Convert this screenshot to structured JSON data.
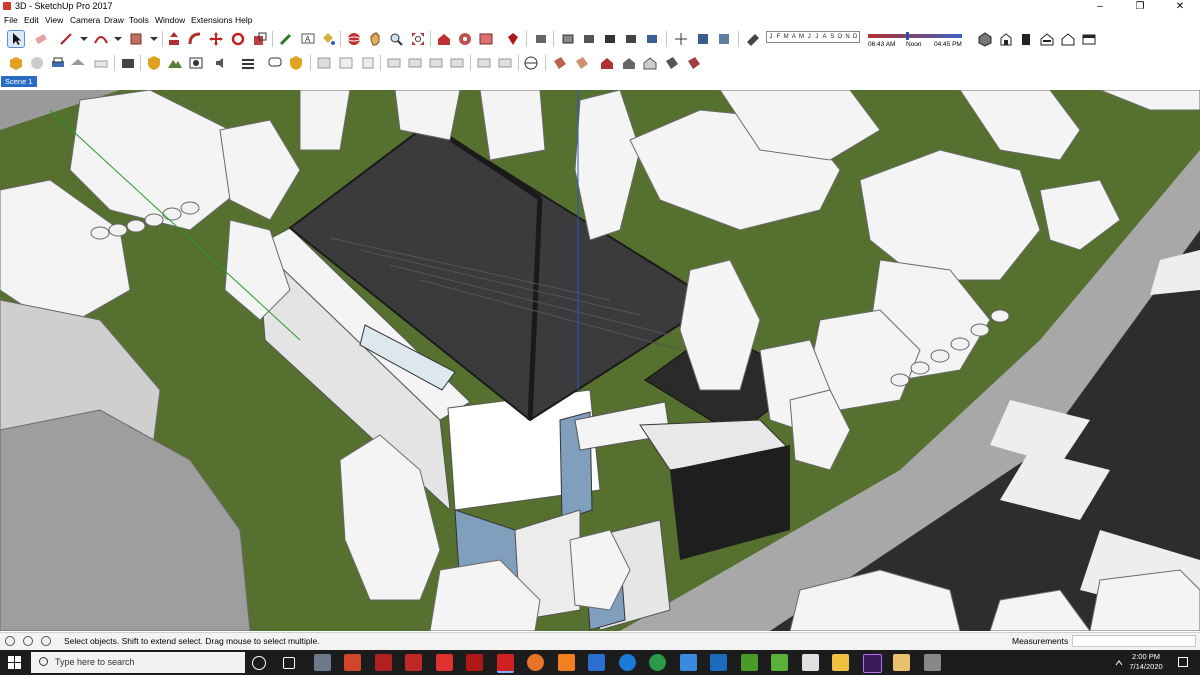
{
  "window": {
    "title": "3D - SketchUp Pro 2017",
    "minimize_icon": "minimize-icon",
    "maximize_icon": "restore-icon",
    "close_icon": "close-icon"
  },
  "menu": [
    "File",
    "Edit",
    "View",
    "Camera",
    "Draw",
    "Tools",
    "Window",
    "Extensions",
    "Help"
  ],
  "toolbar_row1_icons": [
    "select-icon",
    "eraser-icon",
    "line-icon",
    "arc-icon",
    "rectangle-icon",
    "push-pull-icon",
    "follow-me-icon",
    "move-icon",
    "rotate-icon",
    "scale-icon",
    "tape-measure-icon",
    "text-icon",
    "paint-bucket-icon",
    "orbit-icon",
    "pan-icon",
    "zoom-icon",
    "zoom-extents-icon",
    "warehouse-icon",
    "extension-warehouse-icon",
    "layout-icon",
    "sandbox-icon",
    "views-icons",
    "shadow-toggle-icon",
    "iso-view-icon",
    "top-view-icon",
    "front-view-icon",
    "right-view-icon",
    "back-view-icon",
    "left-view-icon"
  ],
  "shadow_settings": {
    "months": [
      "J",
      "F",
      "M",
      "A",
      "M",
      "J",
      "J",
      "A",
      "S",
      "O",
      "N",
      "D"
    ],
    "time_start": "06:43 AM",
    "time_mid": "Noon",
    "time_end": "04:45 PM"
  },
  "scene": {
    "tab_label": "Scene 1"
  },
  "status": {
    "message": "Select objects. Shift to extend select. Drag mouse to select multiple.",
    "measurements_label": "Measurements",
    "measurements_value": ""
  },
  "taskbar": {
    "search_placeholder": "Type here to search",
    "time": "2:00 PM",
    "date": "7/14/2020"
  },
  "colors": {
    "grass": "#4f6b2c",
    "road": "#2b2b2b",
    "sidewalk": "#a9a9a9",
    "roof": "#3b3b3d",
    "wall": "#e6e6e6",
    "accent_blue": "#7f9fbd",
    "scene_tab": "#2a6cc4",
    "taskbar": "#1c1c1c"
  }
}
